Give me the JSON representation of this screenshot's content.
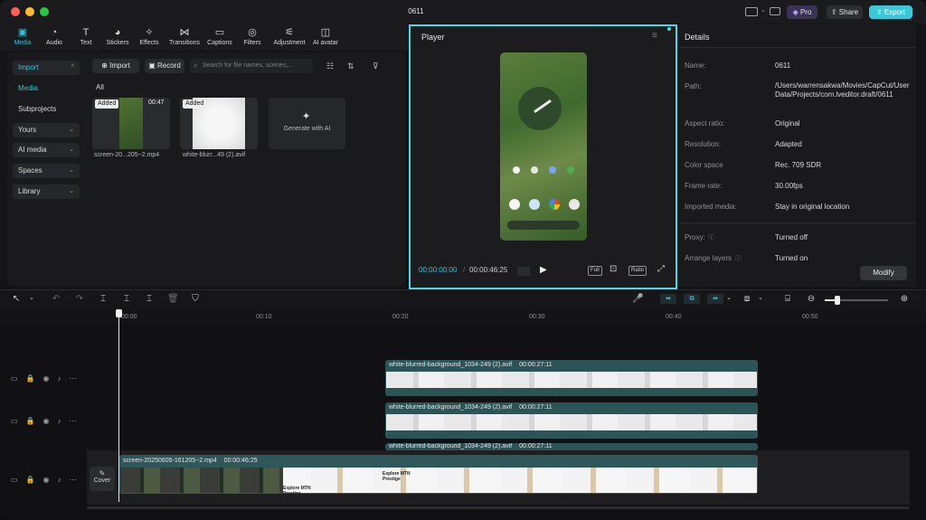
{
  "window": {
    "title": "0611"
  },
  "titlebar": {
    "pro_label": "Pro",
    "share_label": "Share",
    "export_label": "Export",
    "accent": "#3cc7d8"
  },
  "toolbar": {
    "tabs": [
      {
        "label": "Media",
        "icon": "media-icon",
        "glyph": "▣"
      },
      {
        "label": "Audio",
        "icon": "audio-icon",
        "glyph": "◔"
      },
      {
        "label": "Text",
        "icon": "text-icon",
        "glyph": "T"
      },
      {
        "label": "Stickers",
        "icon": "sticker-icon",
        "glyph": "◕"
      },
      {
        "label": "Effects",
        "icon": "effects-icon",
        "glyph": "✧"
      },
      {
        "label": "Transitions",
        "icon": "transition-icon",
        "glyph": "⋈"
      },
      {
        "label": "Captions",
        "icon": "captions-icon",
        "glyph": "▭"
      },
      {
        "label": "Filters",
        "icon": "filters-icon",
        "glyph": "◎"
      },
      {
        "label": "Adjustment",
        "icon": "adjustment-icon",
        "glyph": "⚟"
      },
      {
        "label": "AI avatar",
        "icon": "ai-avatar-icon",
        "glyph": "◫"
      }
    ]
  },
  "sidebar": {
    "import_label": "Import",
    "media_label": "Media",
    "subprojects_label": "Subprojects",
    "yours_label": "Yours",
    "ai_media_label": "AI media",
    "spaces_label": "Spaces",
    "library_label": "Library"
  },
  "media": {
    "import_button": "Import",
    "record_button": "Record",
    "search_placeholder": "Search for file names, scenes,...",
    "filter_all": "All",
    "items": [
      {
        "name": "screen-20...205~2.mp4",
        "badge": "Added",
        "duration": "00:47"
      },
      {
        "name": "white-blurr...49 (2).avif",
        "badge": "Added",
        "duration": ""
      }
    ],
    "generate_label": "Generate with AI"
  },
  "player": {
    "title": "Player",
    "current_time": "00:00:00:00",
    "total_time": "00:00:46:25",
    "full_label": "Full",
    "ratio_label": "Ratio"
  },
  "details": {
    "title": "Details",
    "rows": [
      {
        "label": "Name:",
        "value": "0611"
      },
      {
        "label": "Path:",
        "value": "/Users/warrensakwa/Movies/CapCut/User Data/Projects/com.lveditor.draft/0611"
      },
      {
        "label": "Aspect ratio:",
        "value": "Original"
      },
      {
        "label": "Resolution:",
        "value": "Adapted"
      },
      {
        "label": "Color space",
        "value": "Rec. 709 SDR"
      },
      {
        "label": "Frame rate:",
        "value": "30.00fps"
      },
      {
        "label": "Imported media:",
        "value": "Stay in original location"
      },
      {
        "label": "Proxy:",
        "value": "Turned off"
      },
      {
        "label": "Arrange layers",
        "value": "Turned on"
      }
    ],
    "modify_label": "Modify"
  },
  "timeline": {
    "ruler": [
      "00:00",
      "00:10",
      "00:20",
      "00:30",
      "00:40",
      "00:50"
    ],
    "overlay_clips": [
      {
        "title": "white-blurred-background_1034-249 (2).avif",
        "duration": "00:00:27:11"
      },
      {
        "title": "white-blurred-background_1034-249 (2).avif",
        "duration": "00:00:27:11"
      },
      {
        "title": "white-blurred-background_1034-249 (2).avif",
        "duration": "00:00:27:11"
      }
    ],
    "main_clip": {
      "title": "screen-20250605-161205~2.mp4",
      "duration": "00:00:46:25"
    },
    "cover_label": "Cover",
    "main_strip_labels": [
      "Explore MTN Prestige",
      "Explore MTN Prestige Benefits"
    ]
  }
}
